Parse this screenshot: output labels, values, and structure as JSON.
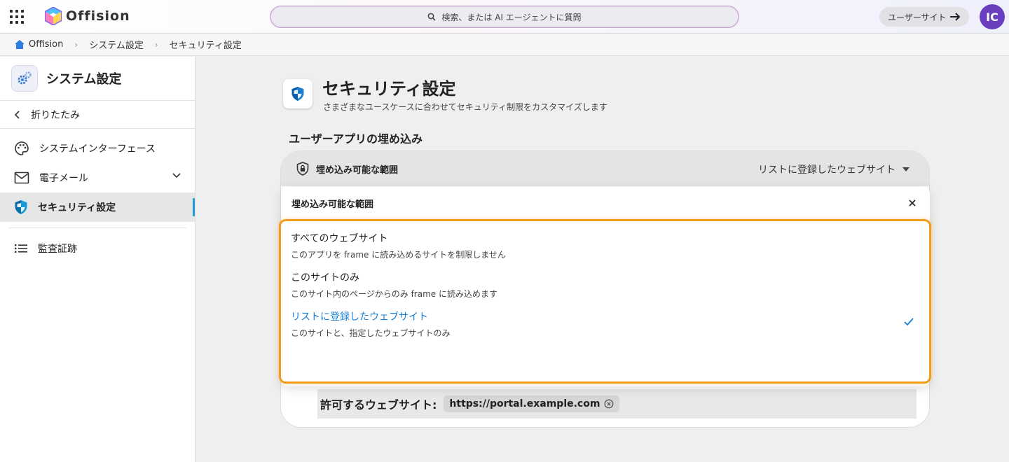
{
  "topbar": {
    "app_name": "Offision",
    "search_placeholder": "検索、または AI エージェントに質問",
    "user_site_label": "ユーザーサイト",
    "avatar_initials": "IC"
  },
  "breadcrumb": [
    "Offision",
    "システム設定",
    "セキュリティ設定"
  ],
  "sidebar": {
    "title": "システム設定",
    "collapse_label": "折りたたみ",
    "items": [
      {
        "label": "システムインターフェース"
      },
      {
        "label": "電子メール"
      },
      {
        "label": "セキュリティ設定"
      },
      {
        "label": "監査証跡"
      }
    ]
  },
  "main": {
    "title": "セキュリティ設定",
    "subtitle": "さまざまなユースケースに合わせてセキュリティ制限をカスタマイズします",
    "section_title": "ユーザーアプリの埋め込み",
    "embed_row": {
      "label": "埋め込み可能な範囲",
      "value": "リストに登録したウェブサイト"
    },
    "allowed": {
      "label": "許可するウェブサイト:",
      "url": "https://portal.example.com"
    }
  },
  "popup": {
    "title": "埋め込み可能な範囲",
    "options": [
      {
        "label": "すべてのウェブサイト",
        "desc": "このアプリを frame に読み込めるサイトを制限しません",
        "selected": false
      },
      {
        "label": "このサイトのみ",
        "desc": "このサイト内のページからのみ frame に読み込めます",
        "selected": false
      },
      {
        "label": "リストに登録したウェブサイト",
        "desc": "このサイトと、指定したウェブサイトのみ",
        "selected": true
      }
    ]
  },
  "colors": {
    "accent": "#1a7fd4",
    "highlight_border": "#f29d1e",
    "avatar": "#6a3fbe",
    "active_indicator": "#1a9ad6"
  }
}
